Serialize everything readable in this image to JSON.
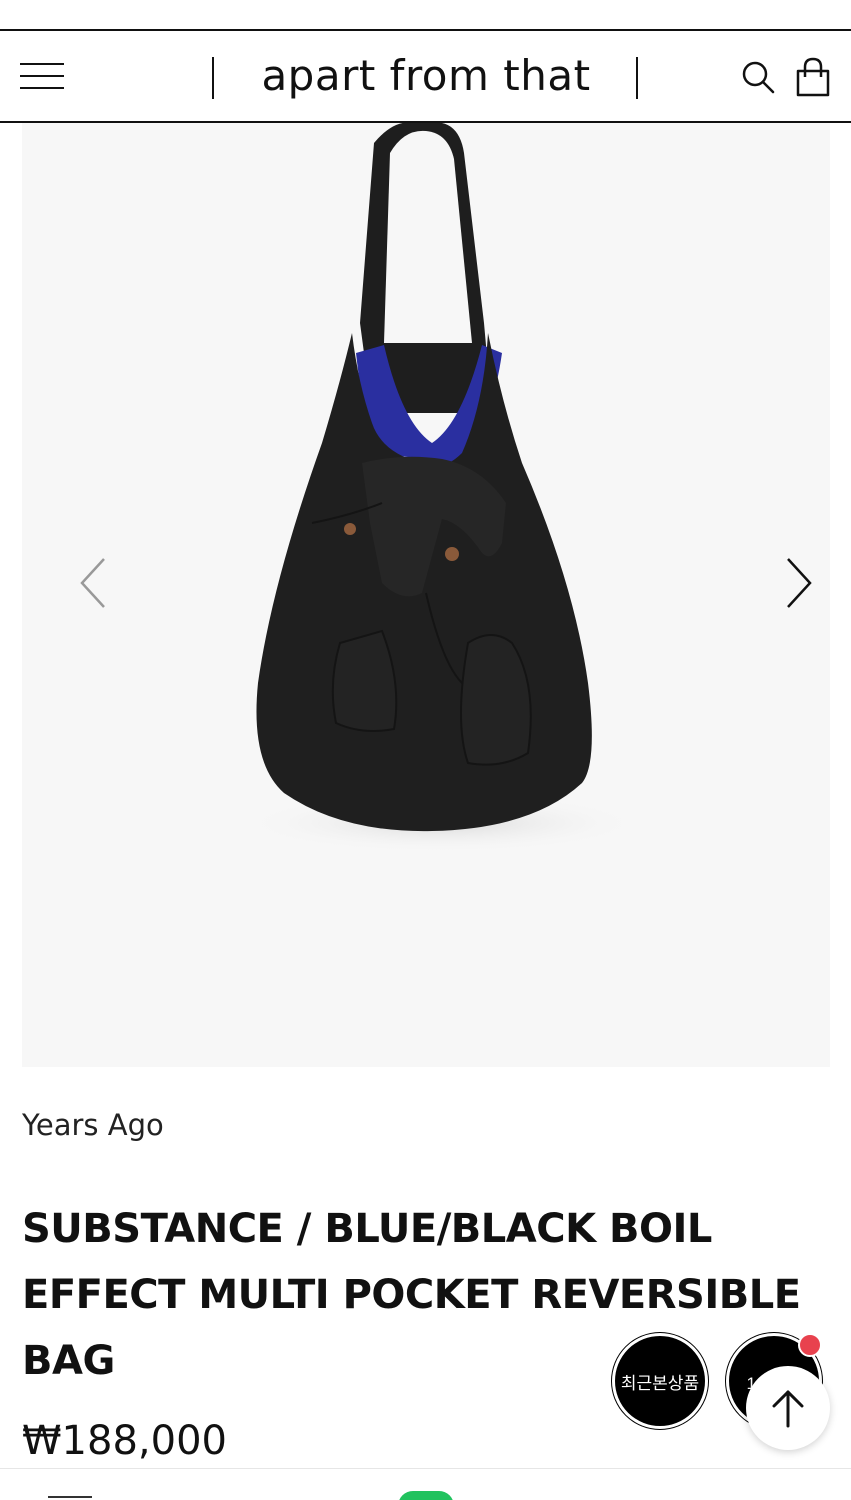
{
  "header": {
    "logo": "apart from that",
    "icons": [
      "hamburger-menu-icon",
      "search-icon",
      "shopping-bag-icon"
    ]
  },
  "gallery": {
    "image": "black reversible shoulder bag with blue lining",
    "icons": [
      "chevron-left-icon",
      "chevron-right-icon"
    ]
  },
  "product": {
    "brand": "Years Ago",
    "title": "SUBSTANCE / BLUE/BLACK BOIL EFFECT MULTI POCKET REVERSIBLE BAG",
    "price": "₩188,000"
  },
  "floating": {
    "recent_label": "최근본상품",
    "chat_label": "1:1문의"
  },
  "colors": {
    "accent_badge": "#e8424e",
    "bottom_green": "#21c25e",
    "lining_blue": "#2a2fa0"
  }
}
